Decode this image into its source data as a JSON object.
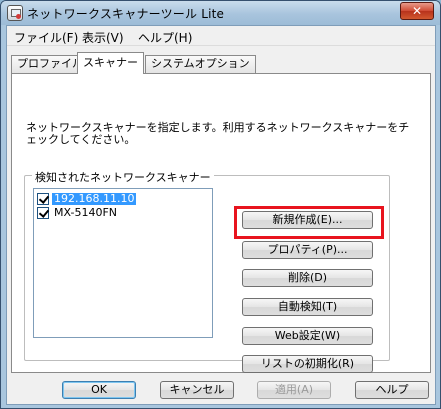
{
  "window": {
    "title": "ネットワークスキャナーツール Lite",
    "close_label": "✕"
  },
  "menubar": {
    "items": [
      {
        "label": "ファイル(F)"
      },
      {
        "label": "表示(V)"
      },
      {
        "label": "ヘルプ(H)"
      }
    ]
  },
  "tabs": [
    {
      "label": "プロファイル",
      "active": false
    },
    {
      "label": "スキャナー",
      "active": true
    },
    {
      "label": "システムオプション",
      "active": false
    }
  ],
  "scanner_tab": {
    "description": "ネットワークスキャナーを指定します。利用するネットワークスキャナーをチェックしてください。",
    "group_label": "検知されたネットワークスキャナー",
    "scanners": [
      {
        "label": "192.168.11.10",
        "checked": true,
        "selected": true
      },
      {
        "label": "MX-5140FN",
        "checked": true,
        "selected": false
      }
    ],
    "buttons": {
      "new": "新規作成(E)...",
      "properties": "プロパティ(P)...",
      "delete": "削除(D)",
      "auto_detect": "自動検知(T)",
      "web_settings": "Web設定(W)",
      "reset_list": "リストの初期化(R)"
    }
  },
  "dialog_buttons": {
    "ok": "OK",
    "cancel": "キャンセル",
    "apply": "適用(A)",
    "help": "ヘルプ"
  },
  "colors": {
    "highlight_box": "#e8141e",
    "selection": "#3399ff"
  }
}
